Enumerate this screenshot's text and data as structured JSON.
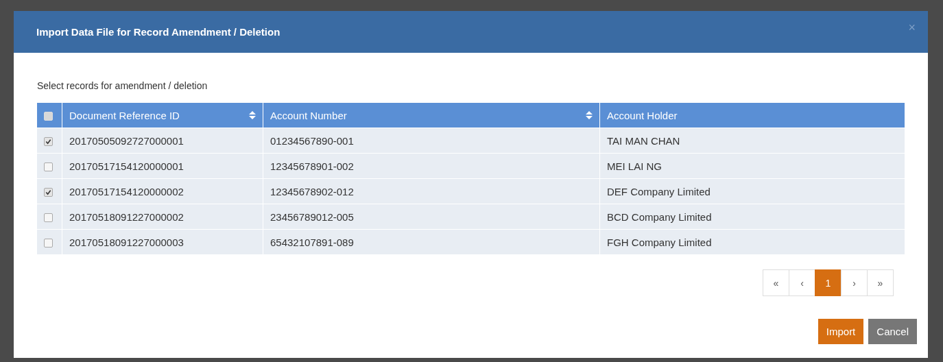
{
  "dialog": {
    "title": "Import Data File for Record Amendment / Deletion",
    "close": "×"
  },
  "instruction": "Select records for amendment / deletion",
  "table": {
    "select_all": {
      "checked": false
    },
    "columns": [
      {
        "label": "Document Reference ID",
        "sortable": true
      },
      {
        "label": "Account Number",
        "sortable": true
      },
      {
        "label": "Account Holder",
        "sortable": false
      }
    ],
    "rows": [
      {
        "checked": true,
        "cells": [
          "20170505092727000001",
          "01234567890-001",
          "TAI MAN CHAN"
        ]
      },
      {
        "checked": false,
        "cells": [
          "20170517154120000001",
          "12345678901-002",
          "MEI LAI NG"
        ]
      },
      {
        "checked": true,
        "cells": [
          "20170517154120000002",
          "12345678902-012",
          "DEF Company Limited"
        ]
      },
      {
        "checked": false,
        "cells": [
          "20170518091227000002",
          "23456789012-005",
          "BCD Company Limited"
        ]
      },
      {
        "checked": false,
        "cells": [
          "20170518091227000003",
          "65432107891-089",
          "FGH Company Limited"
        ]
      }
    ]
  },
  "pagination": [
    {
      "label": "«",
      "selected": false
    },
    {
      "label": "‹",
      "selected": false
    },
    {
      "label": "1",
      "selected": true
    },
    {
      "label": "›",
      "selected": false
    },
    {
      "label": "»",
      "selected": false
    }
  ],
  "buttons": [
    {
      "label": "Import",
      "kind": "primary"
    },
    {
      "label": "Cancel",
      "kind": "secondary"
    }
  ]
}
